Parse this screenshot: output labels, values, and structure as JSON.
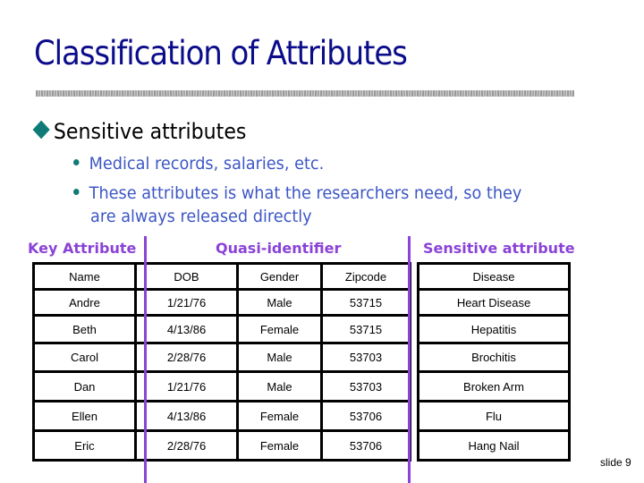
{
  "slide": {
    "title": "Classification of Attributes",
    "main_bullet": "Sensitive attributes",
    "sub_bullets": [
      "Medical records, salaries, etc.",
      "These attributes is what the researchers need, so they",
      "are always released directly"
    ],
    "slide_number": "slide 9"
  },
  "labels": {
    "key": "Key Attribute",
    "quasi": "Quasi-identifier",
    "sensitive": "Sensitive attribute"
  },
  "colors": {
    "title": "#0b0c8a",
    "accent_purple": "#8a43d6",
    "bullet_teal": "#0f7a78",
    "sub_text_blue": "#3c56c4"
  },
  "table": {
    "headers": [
      "Name",
      "DOB",
      "Gender",
      "Zipcode",
      "Disease"
    ],
    "rows": [
      [
        "Andre",
        "1/21/76",
        "Male",
        "53715",
        "Heart Disease"
      ],
      [
        "Beth",
        "4/13/86",
        "Female",
        "53715",
        "Hepatitis"
      ],
      [
        "Carol",
        "2/28/76",
        "Male",
        "53703",
        "Brochitis"
      ],
      [
        "Dan",
        "1/21/76",
        "Male",
        "53703",
        "Broken Arm"
      ],
      [
        "Ellen",
        "4/13/86",
        "Female",
        "53706",
        "Flu"
      ],
      [
        "Eric",
        "2/28/76",
        "Female",
        "53706",
        "Hang Nail"
      ]
    ]
  }
}
